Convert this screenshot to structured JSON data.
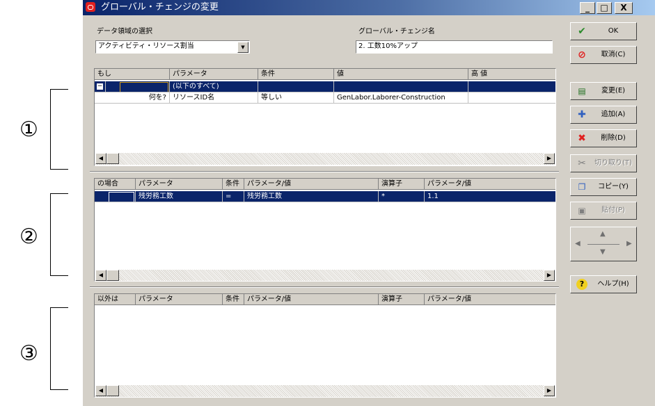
{
  "annotations": [
    "①",
    "②",
    "③"
  ],
  "window": {
    "title": "グローバル・チェンジの変更",
    "caption_buttons": [
      "_",
      "□",
      "X"
    ]
  },
  "top": {
    "data_area_label": "データ領域の選択",
    "data_area_value": "アクティビティ・リソース割当",
    "change_name_label": "グローバル・チェンジ名",
    "change_name_value": "2. 工数10%アップ"
  },
  "grid1": {
    "headers": [
      "もし",
      "パラメータ",
      "条件",
      "値",
      "高 値"
    ],
    "rows": [
      {
        "toggle": "−",
        "what": "",
        "param": "(以下のすべて)",
        "cond": "",
        "value": "",
        "high": ""
      },
      {
        "toggle": "",
        "what": "何を?",
        "param": "リソースID名",
        "cond": "等しい",
        "value": "GenLabor.Laborer-Construction",
        "high": ""
      }
    ]
  },
  "grid2": {
    "headers": [
      "の場合",
      "パラメータ",
      "条件",
      "パラメータ/値",
      "演算子",
      "パラメータ/値"
    ],
    "rows": [
      {
        "case": "",
        "param": "残労務工数",
        "cond": "=",
        "value": "残労務工数",
        "op": "*",
        "value2": "1.1"
      }
    ]
  },
  "grid3": {
    "headers": [
      "以外は",
      "パラメータ",
      "条件",
      "パラメータ/値",
      "演算子",
      "パラメータ/値"
    ],
    "rows": []
  },
  "buttons": {
    "ok": "OK",
    "cancel": "取消(C)",
    "modify": "変更(E)",
    "add": "追加(A)",
    "delete": "削除(D)",
    "cut": "切り取り(T)",
    "copy": "コピー(Y)",
    "paste": "貼付(P)",
    "help": "ヘルプ(H)"
  },
  "icons": {
    "ok": "check-icon",
    "cancel": "prohibit-icon",
    "modify": "edit-row-icon",
    "add": "plus-icon",
    "delete": "x-icon",
    "cut": "scissors-icon",
    "copy": "copy-icon",
    "paste": "paste-icon",
    "help": "help-icon"
  },
  "colors": {
    "selection": "#0a246a",
    "title_start": "#0a246a",
    "title_end": "#a6caf0",
    "face": "#d4d0c8"
  }
}
